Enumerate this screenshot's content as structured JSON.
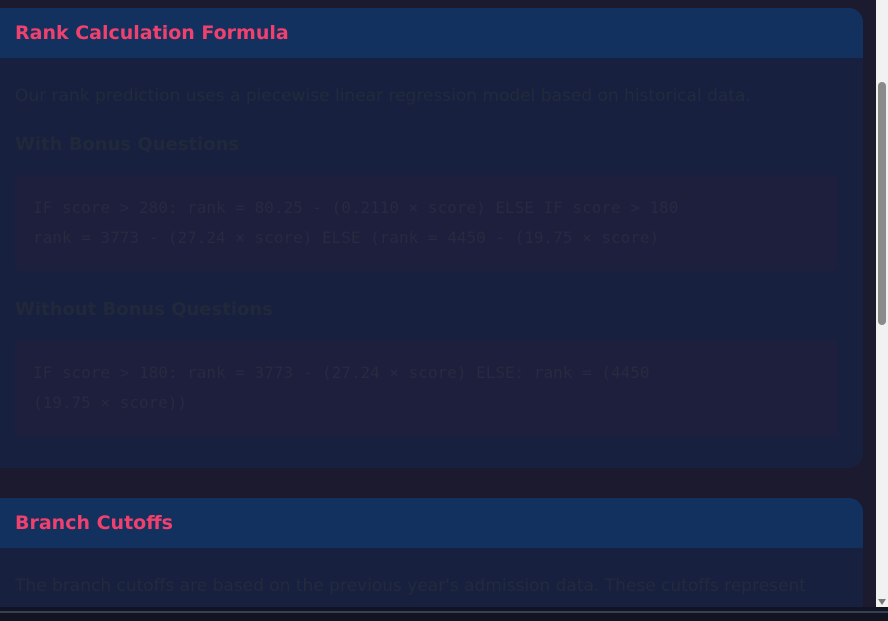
{
  "rank_section": {
    "title": "Rank Calculation Formula",
    "description": "Our rank prediction uses a piecewise linear regression model based on historical data.",
    "with_bonus": {
      "heading": "With Bonus Questions",
      "code": [
        "IF score > 280: rank = 80.25 - (0.2110 × score) ELSE IF score > 180",
        "rank = 3773 - (27.24 × score) ELSE (rank = 4450 - (19.75 × score)"
      ]
    },
    "without_bonus": {
      "heading": "Without Bonus Questions",
      "code": [
        "IF score > 180: rank = 3773 - (27.24 × score) ELSE: rank = (4450",
        "(19.75 × score))"
      ]
    }
  },
  "branch_section": {
    "title": "Branch Cutoffs",
    "description": "The branch cutoffs are based on the previous year's admission data. These cutoffs represent"
  }
}
